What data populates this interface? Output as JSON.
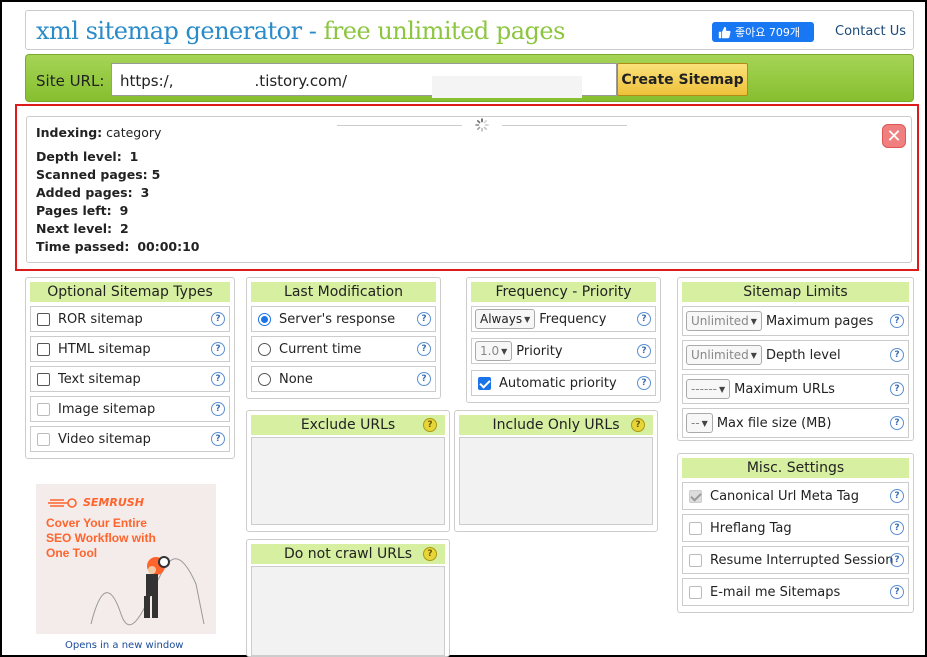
{
  "header": {
    "title_part1": "xml sitemap generator",
    "title_sep": " - ",
    "title_part2": "free unlimited pages",
    "like_label": "좋아요 709개",
    "contact_label": "Contact Us"
  },
  "urlbar": {
    "label": "Site URL:",
    "url_value": "https:/,                 .tistory.com/",
    "create_button": "Create Sitemap"
  },
  "progress": {
    "indexing_label": "Indexing:",
    "indexing_value": "category",
    "stats": [
      {
        "label": "Depth level:",
        "value": "1"
      },
      {
        "label": "Scanned pages:",
        "value": "5"
      },
      {
        "label": "Added pages:",
        "value": "3"
      },
      {
        "label": "Pages left:",
        "value": "9"
      },
      {
        "label": "Next level:",
        "value": "2"
      },
      {
        "label": "Time passed:",
        "value": "00:00:10"
      }
    ],
    "close_glyph": "✕"
  },
  "optional_types": {
    "title": "Optional Sitemap Types",
    "items": [
      {
        "label": "ROR sitemap",
        "checked": false,
        "disabled": false
      },
      {
        "label": "HTML sitemap",
        "checked": false,
        "disabled": false
      },
      {
        "label": "Text sitemap",
        "checked": false,
        "disabled": false
      },
      {
        "label": "Image sitemap",
        "checked": false,
        "disabled": true
      },
      {
        "label": "Video sitemap",
        "checked": false,
        "disabled": true
      }
    ]
  },
  "last_mod": {
    "title": "Last Modification",
    "options": [
      {
        "label": "Server's response",
        "selected": true
      },
      {
        "label": "Current time",
        "selected": false
      },
      {
        "label": "None",
        "selected": false
      }
    ]
  },
  "freq": {
    "title": "Frequency - Priority",
    "frequency_select": "Always",
    "frequency_label": "Frequency",
    "priority_select": "1.0",
    "priority_label": "Priority",
    "auto_priority_label": "Automatic priority"
  },
  "limits": {
    "title": "Sitemap Limits",
    "items": [
      {
        "select": "Unlimited",
        "label": "Maximum pages"
      },
      {
        "select": "Unlimited",
        "label": "Depth level"
      },
      {
        "select": "------",
        "label": "Maximum URLs"
      },
      {
        "select": "--",
        "label": "Max file size (MB)"
      }
    ]
  },
  "exclude": {
    "title": "Exclude URLs"
  },
  "include_only": {
    "title": "Include Only URLs"
  },
  "do_not_crawl": {
    "title": "Do not crawl URLs"
  },
  "misc": {
    "title": "Misc. Settings",
    "items": [
      {
        "label": "Canonical Url Meta Tag",
        "checked": true
      },
      {
        "label": "Hreflang Tag",
        "checked": false
      },
      {
        "label": "Resume Interrupted Session",
        "checked": false
      },
      {
        "label": "E-mail me Sitemaps",
        "checked": false
      }
    ]
  },
  "help_glyph": "?",
  "ad": {
    "brand": "SEMRUSH",
    "headline": "Cover Your Entire SEO Workflow with One Tool",
    "link": "Opens in a new window"
  },
  "colors": {
    "accent_green": "#8cc63f",
    "title_blue": "#2a8bc9",
    "panel_header": "#d6efa0",
    "highlight_red": "#dd1b1b"
  }
}
